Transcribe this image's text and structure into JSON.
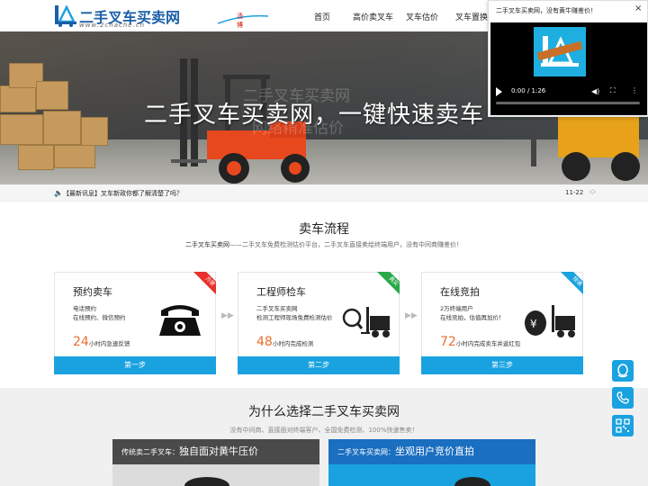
{
  "site": {
    "logo_name": "二手叉车买卖网",
    "logo_url": "www.2chache.cn",
    "logo_signature": "汤博"
  },
  "nav": {
    "items": [
      "首页",
      "高价卖叉车",
      "叉车估价",
      "叉车置换"
    ]
  },
  "hero": {
    "title": "二手叉车买卖网，一键快速卖车",
    "ghost_line1": "二手叉车买卖网",
    "ghost_line2": "网络精准估价",
    "slides": 4,
    "active_slide": 2
  },
  "popup": {
    "title": "二手叉车买卖网，没有黄牛赚差价！",
    "close": "×",
    "time": "0:00 / 1:26"
  },
  "news": {
    "text": "【最新讯息】叉车新政你都了解清楚了吗？",
    "date": "11-22"
  },
  "process": {
    "title": "卖车流程",
    "subtitle_brand": "二手叉车买卖网",
    "subtitle": "——二手叉车免费检测估价平台，二手叉车直接卖给终端用户，没有中间商赚差价！",
    "cards": [
      {
        "title": "预约卖车",
        "lines": [
          "电话预约",
          "在线预约、微信预约"
        ],
        "num": "24",
        "unit": "小时内急速反馈",
        "button": "第一步",
        "ribbon": "方便",
        "ribbon_color": "#e8312a"
      },
      {
        "title": "工程师检车",
        "lines": [
          "二手叉车买卖网",
          "检测工程师现场免费检测估价"
        ],
        "num": "48",
        "unit": "小时内完成检测",
        "button": "第二步",
        "ribbon": "真实",
        "ribbon_color": "#2aa84a"
      },
      {
        "title": "在线竞拍",
        "lines": [
          "2万终端用户",
          "在线竞拍，估值再加价！"
        ],
        "num": "72",
        "unit": "小时内完成卖车并返红包",
        "button": "第三步",
        "ribbon": "快速",
        "ribbon_color": "#1aa2e0"
      }
    ]
  },
  "why": {
    "title": "为什么选择二手叉车买卖网",
    "subtitle": "没有中间商、直接面对终端客户、全国免费检测、100%快速售卖！",
    "left_label": "传统卖二手叉车：",
    "left_text": "独自面对黄牛压价",
    "right_label": "二手叉车买卖网：",
    "right_text": "坐观用户竞价直拍"
  },
  "colors": {
    "accent": "#1aa2e0",
    "orange": "#e8702a",
    "brand_blue": "#1a5fa8"
  }
}
